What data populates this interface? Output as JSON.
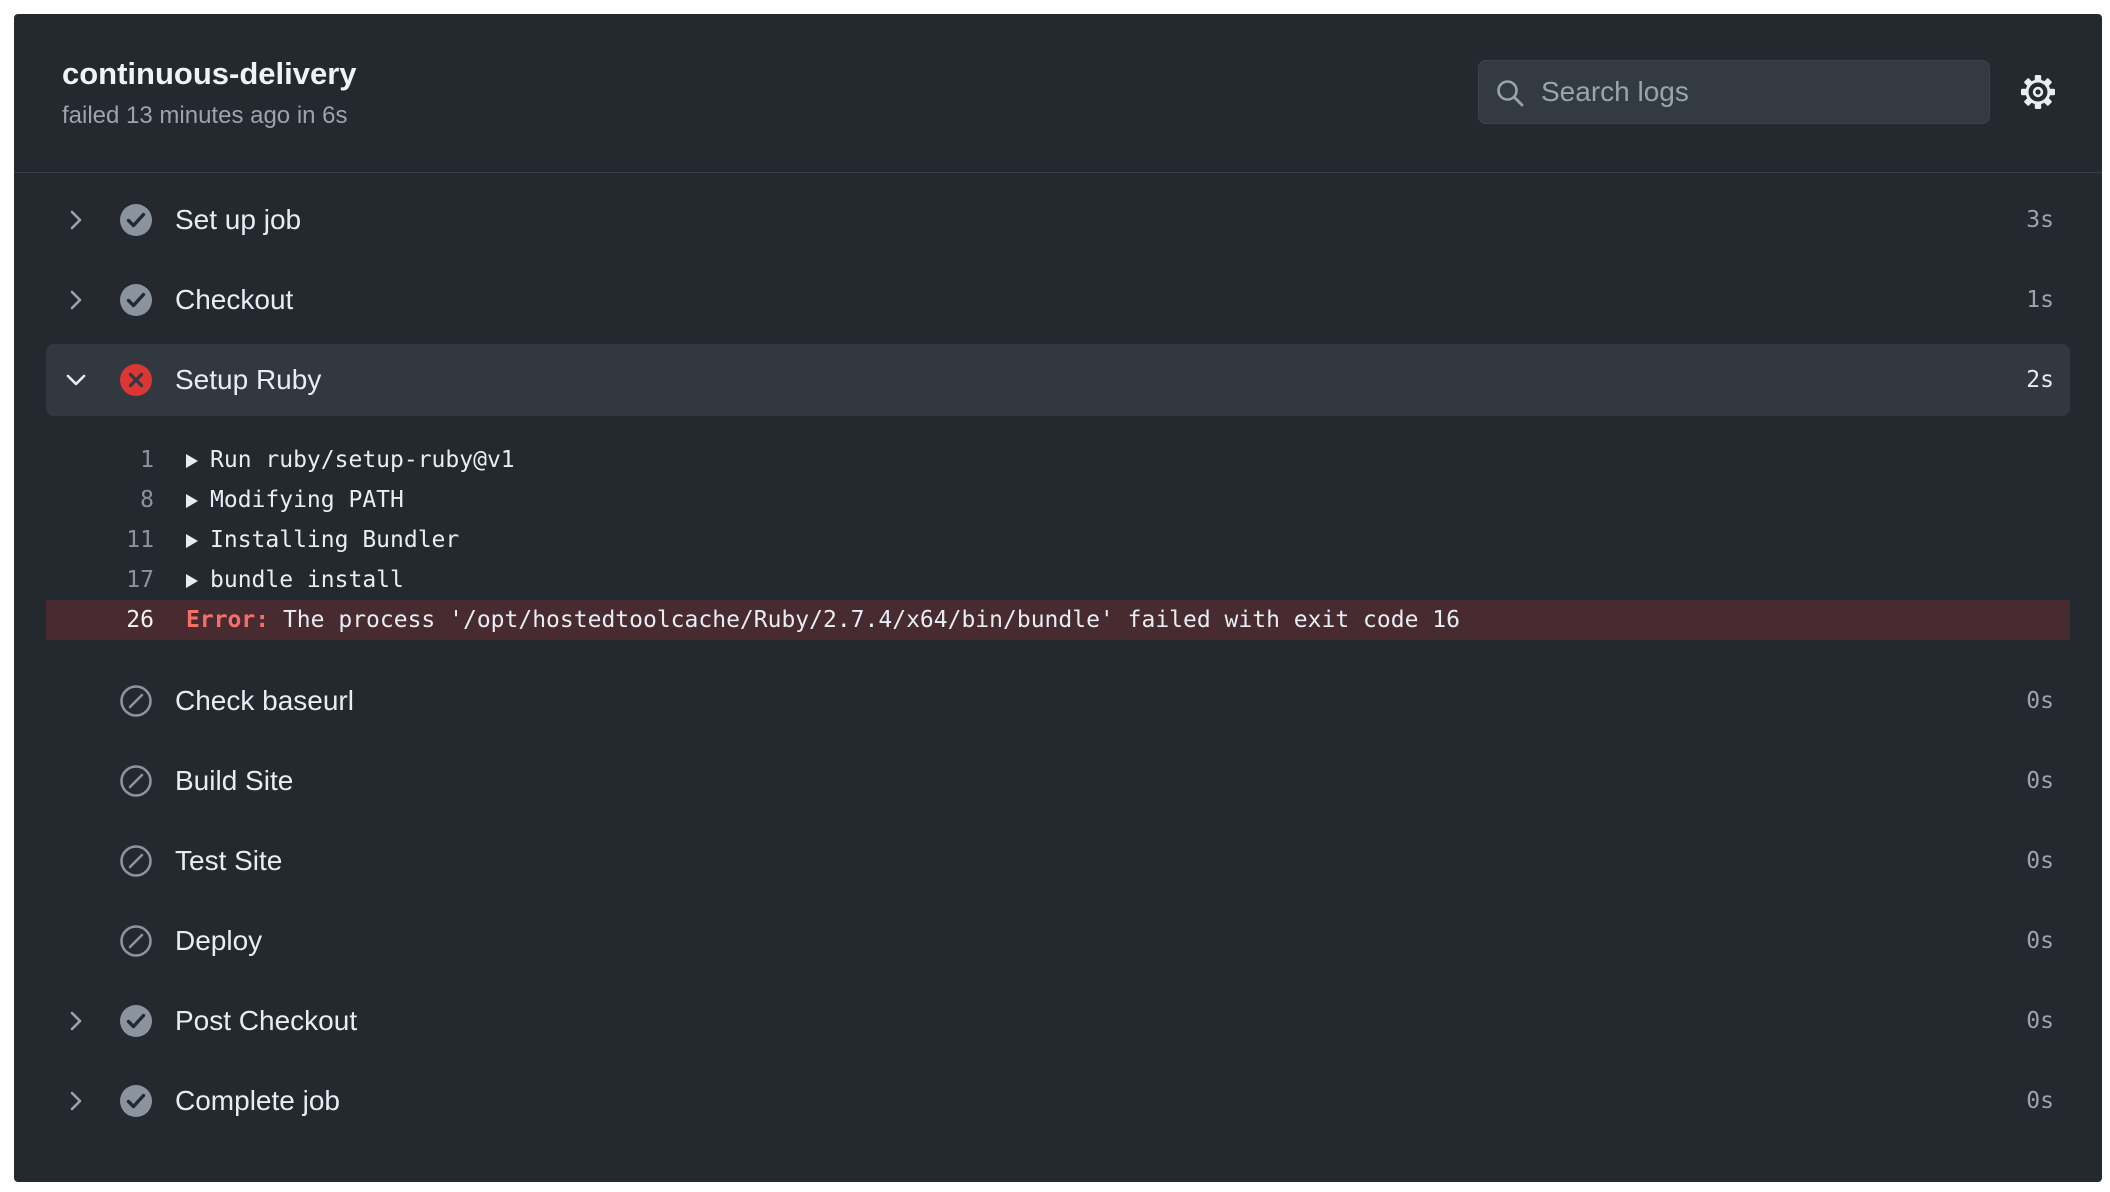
{
  "header": {
    "title": "continuous-delivery",
    "subtitle": "failed 13 minutes ago in 6s"
  },
  "search": {
    "placeholder": "Search logs"
  },
  "colors": {
    "background": "#24292f",
    "success_icon": "#8b949e",
    "failure_icon": "#da3633",
    "error_line_background": "#482b31",
    "error_label": "#f47067"
  },
  "steps": [
    {
      "name": "Set up job",
      "duration": "3s",
      "status": "success",
      "chevron": "chevron-right-icon"
    },
    {
      "name": "Checkout",
      "duration": "1s",
      "status": "success",
      "chevron": "chevron-right-icon"
    },
    {
      "name": "Setup Ruby",
      "duration": "2s",
      "status": "failure",
      "chevron": "chevron-down-icon",
      "expanded": true
    },
    {
      "name": "Check baseurl",
      "duration": "0s",
      "status": "skipped"
    },
    {
      "name": "Build Site",
      "duration": "0s",
      "status": "skipped"
    },
    {
      "name": "Test Site",
      "duration": "0s",
      "status": "skipped"
    },
    {
      "name": "Deploy",
      "duration": "0s",
      "status": "skipped"
    },
    {
      "name": "Post Checkout",
      "duration": "0s",
      "status": "success",
      "chevron": "chevron-right-icon"
    },
    {
      "name": "Complete job",
      "duration": "0s",
      "status": "success",
      "chevron": "chevron-right-icon"
    }
  ],
  "logs": [
    {
      "line": "1",
      "text": "Run ruby/setup-ruby@v1",
      "type": "group"
    },
    {
      "line": "8",
      "text": "Modifying PATH",
      "type": "group"
    },
    {
      "line": "11",
      "text": "Installing Bundler",
      "type": "group"
    },
    {
      "line": "17",
      "text": "bundle install",
      "type": "group"
    },
    {
      "line": "26",
      "label": "Error:",
      "text": "The process '/opt/hostedtoolcache/Ruby/2.7.4/x64/bin/bundle' failed with exit code 16",
      "type": "error"
    }
  ]
}
